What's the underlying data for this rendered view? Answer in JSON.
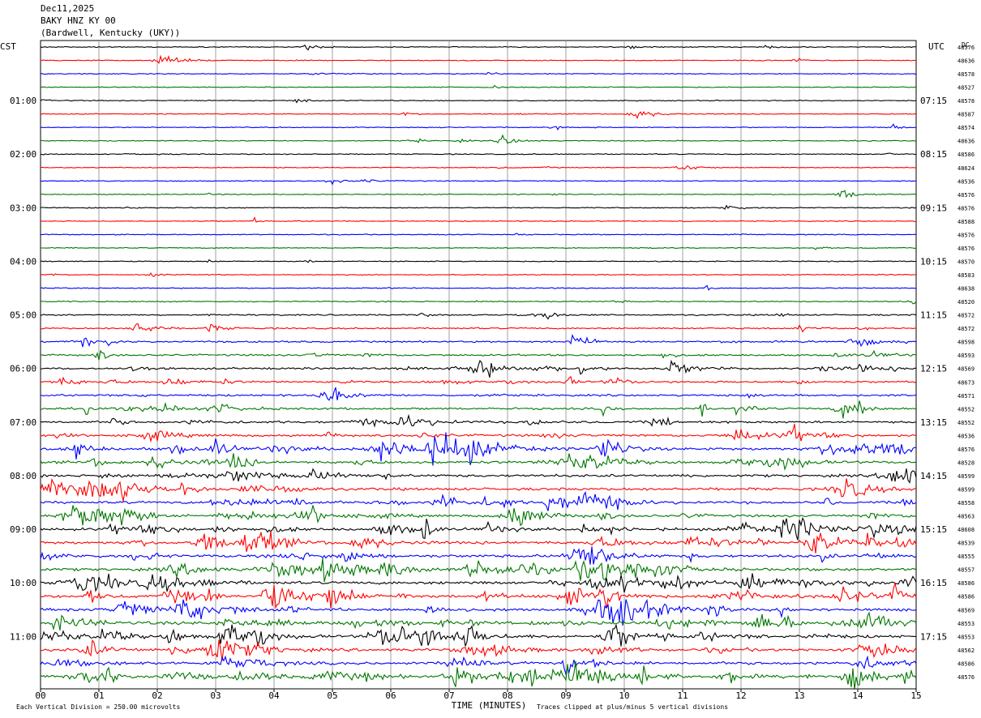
{
  "header": {
    "date": "Dec11,2025",
    "station": "BAKY HNZ KY 00",
    "location": "(Bardwell, Kentucky (UKY))"
  },
  "chart_data": {
    "type": "line",
    "plot_kind": "helicorder seismogram",
    "left_axis_label": "CST",
    "right_axis_label": "UTC",
    "dc_label": "DC",
    "left_time_labels": [
      "01:00",
      "02:00",
      "03:00",
      "04:00",
      "05:00",
      "06:00",
      "07:00",
      "08:00",
      "09:00",
      "10:00",
      "11:00"
    ],
    "right_time_labels": [
      "07:15",
      "08:15",
      "09:15",
      "10:15",
      "11:15",
      "12:15",
      "13:15",
      "14:15",
      "15:15",
      "16:15",
      "17:15"
    ],
    "x_ticks": [
      "00",
      "01",
      "02",
      "03",
      "04",
      "05",
      "06",
      "07",
      "08",
      "09",
      "10",
      "11",
      "12",
      "13",
      "14",
      "15"
    ],
    "xlabel": "TIME (MINUTES)",
    "xlim": [
      0,
      15
    ],
    "trace_minutes": 15,
    "trace_count": 48,
    "trace_color_cycle": [
      "#000000",
      "#ff0000",
      "#0000ff",
      "#007700"
    ],
    "dc_offsets": [
      "48576",
      "48636",
      "48578",
      "48527",
      "48578",
      "48587",
      "48574",
      "48636",
      "48586",
      "48624",
      "48536",
      "48576",
      "48576",
      "48588",
      "48576",
      "48576",
      "48570",
      "48583",
      "48638",
      "48520",
      "48572",
      "48572",
      "48598",
      "48593",
      "48569",
      "48673",
      "48571",
      "48552",
      "48552",
      "48536",
      "48576",
      "48528",
      "48599",
      "48599",
      "48558",
      "48563",
      "48608",
      "48539",
      "48555",
      "48557",
      "48586",
      "48586",
      "48569",
      "48553",
      "48553",
      "48562",
      "48586",
      "48576"
    ],
    "activity_profile": [
      0.1,
      0.08,
      0.08,
      0.08,
      0.1,
      0.08,
      0.08,
      0.08,
      0.12,
      0.08,
      0.08,
      0.08,
      0.1,
      0.08,
      0.08,
      0.09,
      0.1,
      0.1,
      0.12,
      0.15,
      0.3,
      0.35,
      0.45,
      0.5,
      0.55,
      0.55,
      0.55,
      0.6,
      0.7,
      0.75,
      0.95,
      0.85,
      0.85,
      0.9,
      0.8,
      0.8,
      1.0,
      1.0,
      0.95,
      0.95,
      1.0,
      1.0,
      1.0,
      0.95,
      1.0,
      1.0,
      1.0,
      1.0
    ],
    "footer_note_left": "Each Vertical Division =  250.00 microvolts",
    "footer_note_right": "Traces clipped at plus/minus 5 vertical divisions",
    "ylim": [
      0,
      48
    ],
    "grid": true
  }
}
